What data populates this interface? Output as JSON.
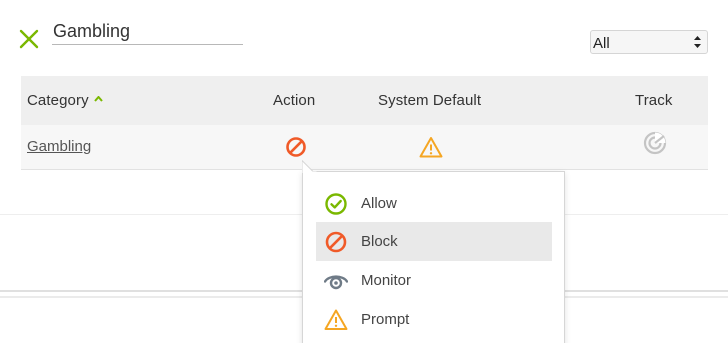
{
  "search": {
    "value": "Gambling"
  },
  "filter": {
    "selected": "All"
  },
  "table": {
    "columns": {
      "category": "Category",
      "action": "Action",
      "system_default": "System Default",
      "track": "Track"
    },
    "rows": [
      {
        "category": "Gambling",
        "action": "block-icon",
        "system_default": "warning-icon",
        "track": "track-icon"
      }
    ]
  },
  "action_menu": {
    "items": [
      {
        "label": "Allow",
        "icon": "allow-icon"
      },
      {
        "label": "Block",
        "icon": "block-icon",
        "selected": true
      },
      {
        "label": "Monitor",
        "icon": "eye-icon"
      },
      {
        "label": "Prompt",
        "icon": "warning-icon"
      }
    ]
  },
  "colors": {
    "accent_green": "#7ab800",
    "block_orange": "#f05a28",
    "warning_amber": "#f5a623",
    "monitor_slate": "#6f7b87"
  }
}
